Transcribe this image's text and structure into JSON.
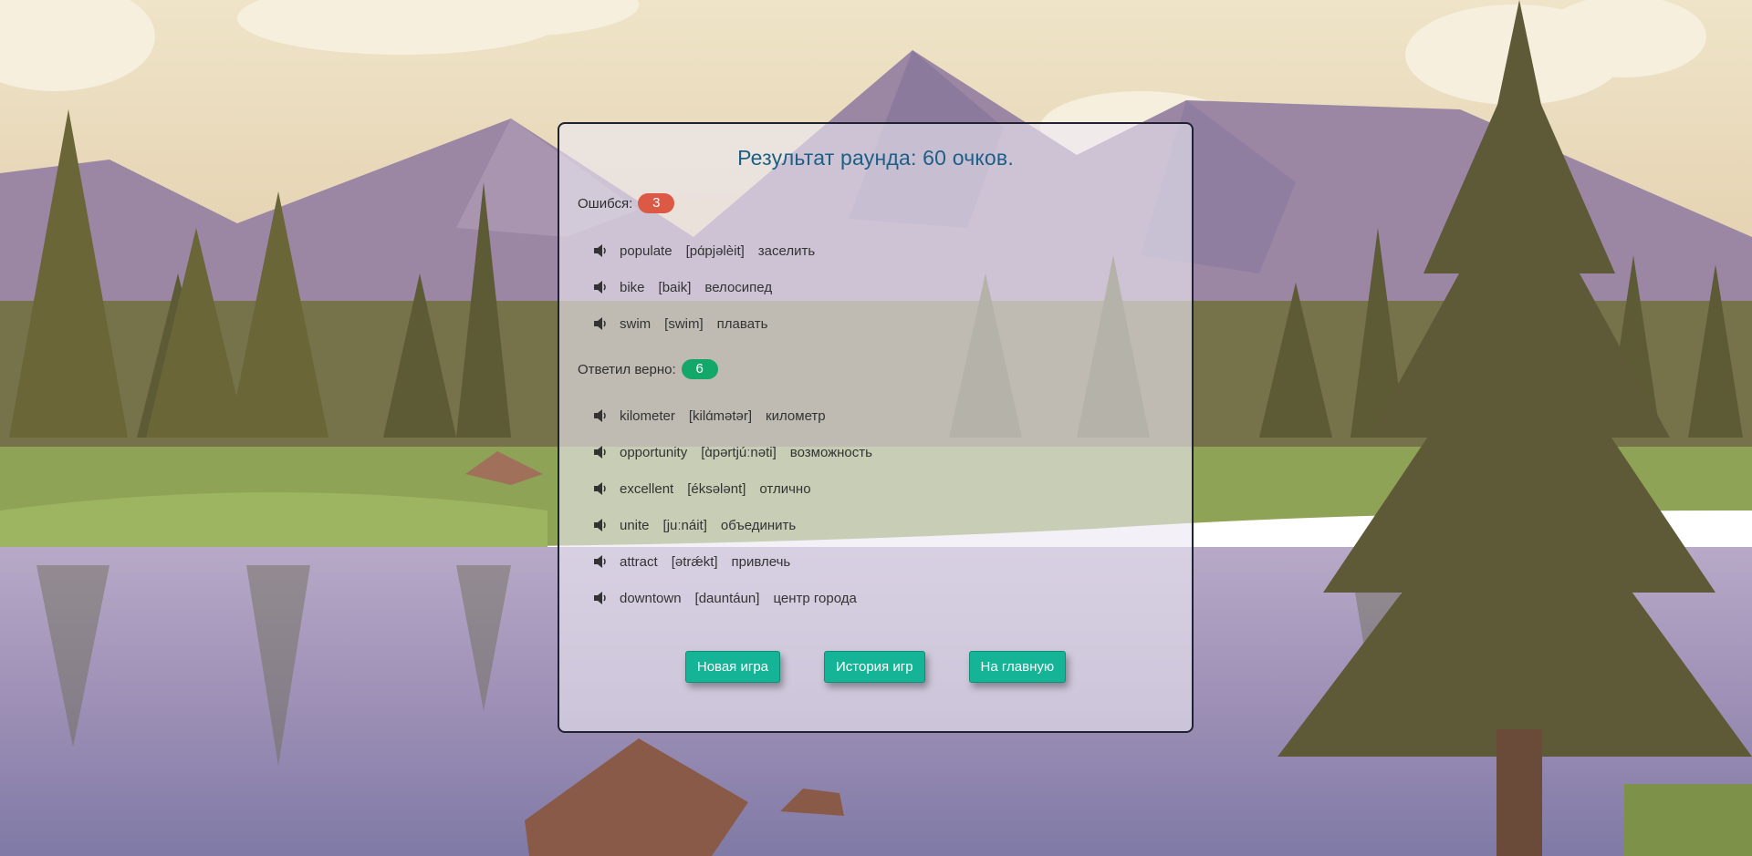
{
  "title": "Результат раунда: 60 очков.",
  "mistakes": {
    "label": "Ошибся:",
    "count": "3",
    "words": [
      {
        "word": "populate",
        "transcription": "[pɑ́pjəlèit]",
        "translation": "заселить"
      },
      {
        "word": "bike",
        "transcription": "[baik]",
        "translation": "велосипед"
      },
      {
        "word": "swim",
        "transcription": "[swim]",
        "translation": "плавать"
      }
    ]
  },
  "correct": {
    "label": "Ответил верно:",
    "count": "6",
    "words": [
      {
        "word": "kilometer",
        "transcription": "[kilɑ́mətər]",
        "translation": "километр"
      },
      {
        "word": "opportunity",
        "transcription": "[ɑ̀pərtjúːnəti]",
        "translation": "возможность"
      },
      {
        "word": "excellent",
        "transcription": "[éksələnt]",
        "translation": "отлично"
      },
      {
        "word": "unite",
        "transcription": "[juːnáit]",
        "translation": "объединить"
      },
      {
        "word": "attract",
        "transcription": "[ətrǽkt]",
        "translation": "привлечь"
      },
      {
        "word": "downtown",
        "transcription": "[dauntáun]",
        "translation": "центр города"
      }
    ]
  },
  "buttons": {
    "new_game": "Новая игра",
    "history": "История игр",
    "home": "На главную"
  },
  "colors": {
    "title": "#1d5f86",
    "mistake_badge": "#dc5a45",
    "correct_badge": "#13a86a",
    "button": "#16b497"
  },
  "icons": {
    "speaker": "speaker-icon"
  }
}
